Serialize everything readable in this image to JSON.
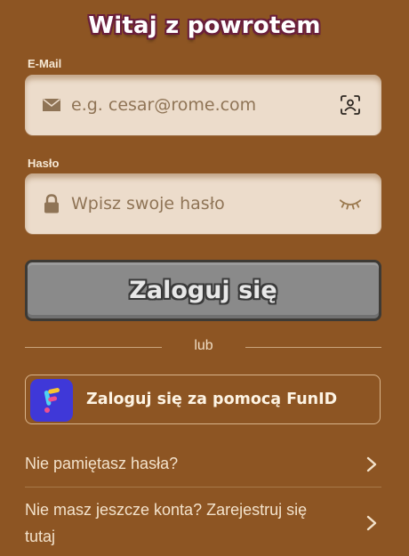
{
  "header": {
    "title": "Witaj z powrotem"
  },
  "email": {
    "label": "E-Mail",
    "placeholder": "e.g. cesar@rome.com",
    "lead_icon": "envelope-icon",
    "trail_icon": "face-scan-icon"
  },
  "password": {
    "label": "Hasło",
    "placeholder": "Wpisz swoje hasło",
    "lead_icon": "lock-icon",
    "trail_icon": "eye-closed-icon"
  },
  "login_button": {
    "label": "Zaloguj się"
  },
  "separator": {
    "text": "lub"
  },
  "funid": {
    "label": "Zaloguj się za pomocą FunID",
    "icon": "funid-logo-icon"
  },
  "links": [
    {
      "label": "Nie pamiętasz hasła?",
      "icon": "chevron-right-icon"
    },
    {
      "label_line1": "Nie masz jeszcze konta? Zarejestruj się",
      "label_line2": "tutaj",
      "icon": "chevron-right-icon"
    }
  ],
  "colors": {
    "background": "#8d5523",
    "field": "#ecdccb",
    "button_disabled": "#8a8a8a",
    "funid_brand": "#3f38d8"
  }
}
